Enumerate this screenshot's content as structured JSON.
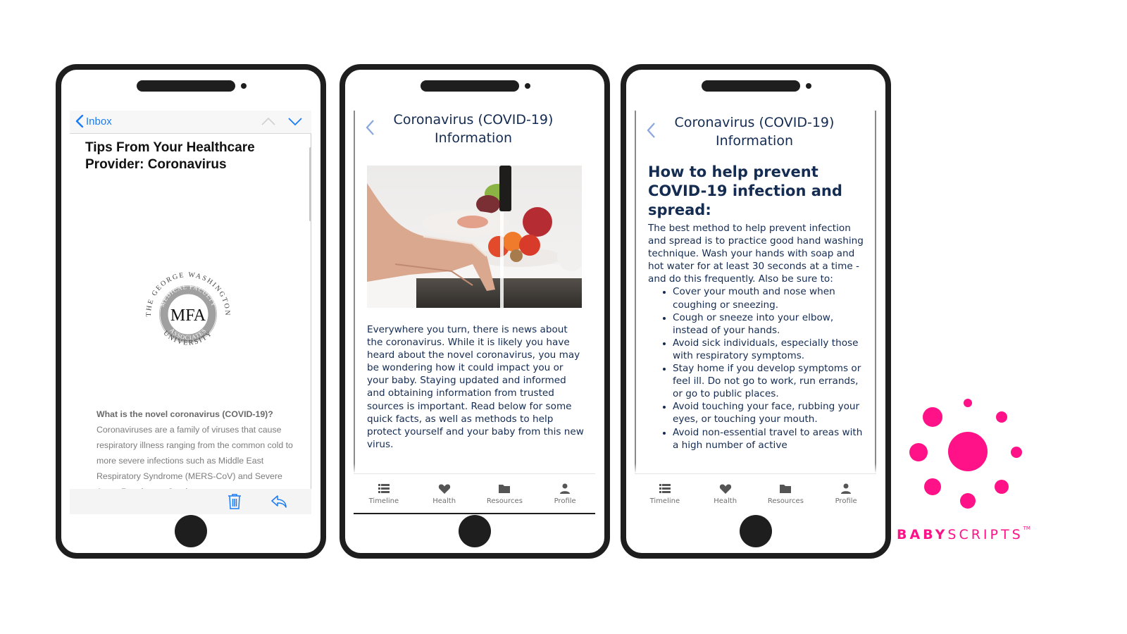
{
  "brand": {
    "accent_color": "#ff1188",
    "navy_text_color": "#142b52",
    "ios_blue": "#1a7cf5",
    "wordmark_bold": "BABY",
    "wordmark_light": "SCRIPTS",
    "trademark": "TM"
  },
  "mail_screen": {
    "back_label": "Inbox",
    "subject": "Tips From Your Healthcare Provider: Coronavirus",
    "logo": {
      "top_arc": "THE GEORGE WASHINGTON",
      "inner_top": "MEDICAL FACULTY",
      "center": "MFA",
      "inner_bottom": "ASSOCIATES",
      "bottom_arc": "UNIVERSITY"
    },
    "body_question": "What is the novel coronavirus (COVID-19)?",
    "body_text": "Coronaviruses are a family of viruses that cause respiratory illness ranging from the common cold to more severe infections such as Middle East Respiratory Syndrome (MERS-CoV) and Severe Acute Respiratory Syndrome",
    "toolbar": {
      "trash_icon": "trash-icon",
      "reply_icon": "reply-icon"
    }
  },
  "info_screen": {
    "title": "Coronavirus (COVID-19) Information",
    "image_alt": "Hands being washed under running kitchen faucet",
    "intro": "Everywhere you turn, there is news about the coronavirus. While it is likely you have heard about the novel coronavirus, you may be wondering how it could impact you or your baby. Staying updated and informed and obtaining information from trusted sources is important. Read below for some quick facts, as well as methods to help protect yourself and your baby from this new virus."
  },
  "prevention_screen": {
    "title": "Coronavirus (COVID-19) Information",
    "heading": "How to help prevent COVID-19 infection and spread:",
    "body": "The best method to help prevent infection and spread is to practice good hand washing technique. Wash your hands with soap and hot water for at least 30 seconds at a time - and do this frequently. Also be sure to:",
    "bullets": [
      "Cover your mouth and nose when coughing or sneezing.",
      "Cough or sneeze into your elbow, instead of your hands.",
      "Avoid sick individuals, especially those with respiratory symptoms.",
      "Stay home if you develop symptoms or feel ill. Do not go to work, run errands, or go to public places.",
      "Avoid touching your face, rubbing your eyes, or touching your mouth.",
      "Avoid non-essential travel to areas with a high number of active"
    ]
  },
  "tabbar": {
    "items": [
      {
        "label": "Timeline",
        "icon": "list-icon"
      },
      {
        "label": "Health",
        "icon": "heart-icon"
      },
      {
        "label": "Resources",
        "icon": "folder-icon"
      },
      {
        "label": "Profile",
        "icon": "person-icon"
      }
    ]
  }
}
